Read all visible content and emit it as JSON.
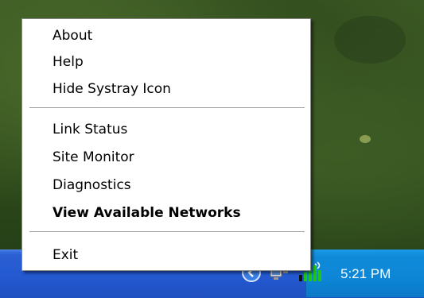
{
  "menu": {
    "items": [
      {
        "label": "About"
      },
      {
        "label": "Help"
      },
      {
        "label": "Hide Systray Icon"
      },
      {
        "label": "Link Status"
      },
      {
        "label": "Site Monitor"
      },
      {
        "label": "Diagnostics"
      },
      {
        "label": "View Available Networks",
        "bold": true
      },
      {
        "label": "Exit"
      }
    ]
  },
  "tray": {
    "clock": "5:21 PM",
    "icons": [
      "show-hidden-icons-chevron-icon",
      "network-connections-icon",
      "wireless-signal-icon"
    ]
  },
  "colors": {
    "taskbar": "#245ad2",
    "tray": "#0d86d6",
    "menu_background": "#ffffff",
    "signal_green": "#22c41a"
  }
}
